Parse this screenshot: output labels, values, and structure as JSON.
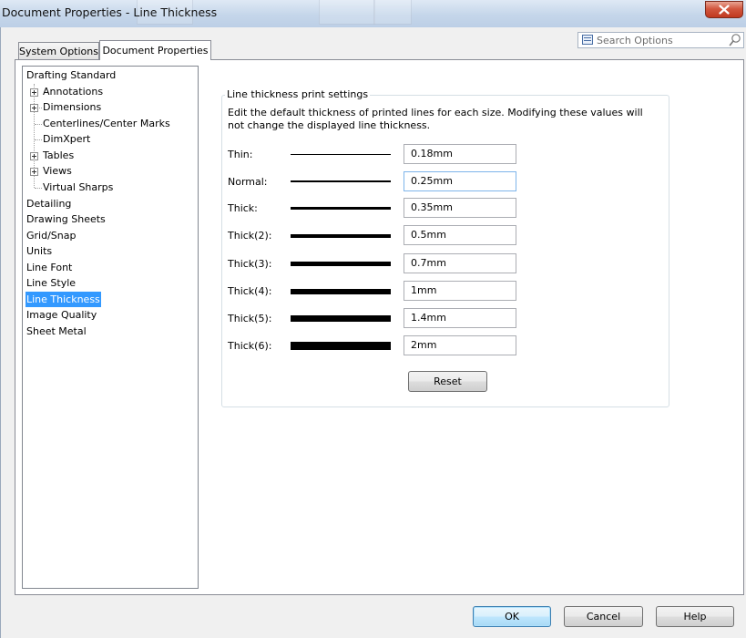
{
  "window": {
    "title": "Document Properties - Line Thickness",
    "close_symbol": "X"
  },
  "search": {
    "placeholder": "Search Options"
  },
  "tabs": [
    {
      "label": "System Options",
      "active": false
    },
    {
      "label": "Document Properties",
      "active": true
    }
  ],
  "tree": [
    {
      "label": "Drafting Standard"
    },
    {
      "label": "Annotations",
      "expandable": true
    },
    {
      "label": "Dimensions",
      "expandable": true
    },
    {
      "label": "Centerlines/Center Marks"
    },
    {
      "label": "DimXpert"
    },
    {
      "label": "Tables",
      "expandable": true
    },
    {
      "label": "Views",
      "expandable": true
    },
    {
      "label": "Virtual Sharps"
    },
    {
      "label": "Detailing"
    },
    {
      "label": "Drawing Sheets"
    },
    {
      "label": "Grid/Snap"
    },
    {
      "label": "Units"
    },
    {
      "label": "Line Font"
    },
    {
      "label": "Line Style"
    },
    {
      "label": "Line Thickness",
      "selected": true
    },
    {
      "label": "Image Quality"
    },
    {
      "label": "Sheet Metal"
    }
  ],
  "settings": {
    "group_title": "Line thickness print settings",
    "description": "Edit the default thickness of printed lines for each size.  Modifying these values will not change the displayed line thickness.",
    "rows": [
      {
        "label": "Thin:",
        "value": "0.18mm"
      },
      {
        "label": "Normal:",
        "value": "0.25mm"
      },
      {
        "label": "Thick:",
        "value": "0.35mm"
      },
      {
        "label": "Thick(2):",
        "value": "0.5mm"
      },
      {
        "label": "Thick(3):",
        "value": "0.7mm"
      },
      {
        "label": "Thick(4):",
        "value": "1mm"
      },
      {
        "label": "Thick(5):",
        "value": "1.4mm"
      },
      {
        "label": "Thick(6):",
        "value": "2mm"
      }
    ],
    "reset_label": "Reset"
  },
  "footer": {
    "ok_label": "OK",
    "cancel_label": "Cancel",
    "help_label": "Help"
  }
}
